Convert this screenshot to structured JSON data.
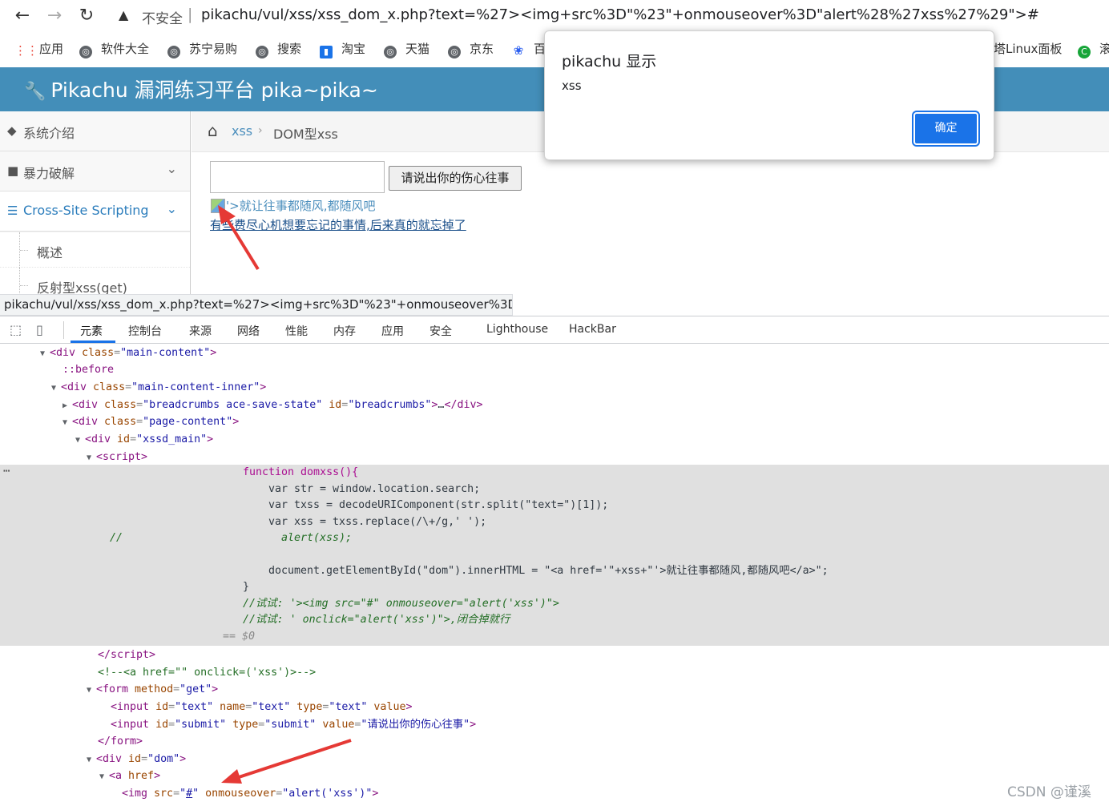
{
  "browser": {
    "back_icon": "back-arrow-icon",
    "forward_icon": "forward-arrow-icon",
    "reload_icon": "reload-icon",
    "insecure_label": "不安全",
    "url": "pikachu/vul/xss/xss_dom_x.php?text=%27><img+src%3D\"%23\"+onmouseover%3D\"alert%28%27xss%27%29\">#",
    "bookmarks": [
      {
        "label": "应用",
        "icon": "apps-grid-icon"
      },
      {
        "label": "软件大全",
        "icon": "globe-icon"
      },
      {
        "label": "苏宁易购",
        "icon": "globe-icon"
      },
      {
        "label": "搜索",
        "icon": "globe-icon"
      },
      {
        "label": "淘宝",
        "icon": "taobao-icon"
      },
      {
        "label": "天猫",
        "icon": "globe-icon"
      },
      {
        "label": "京东",
        "icon": "globe-icon"
      },
      {
        "label": "百",
        "icon": "baidu-paw-icon"
      },
      {
        "label": "塔Linux面板",
        "icon": "globe-icon"
      },
      {
        "label": "滚",
        "icon": "green-c-icon"
      }
    ]
  },
  "app": {
    "title": "Pikachu 漏洞练习平台 pika~pika~",
    "sidebar": [
      {
        "label": "系统介绍"
      },
      {
        "label": "暴力破解"
      },
      {
        "label": "Cross-Site Scripting"
      }
    ],
    "submenu": [
      {
        "label": "概述"
      },
      {
        "label": "反射型xss(get)"
      }
    ],
    "breadcrumb": {
      "xss": "xss",
      "sep": "›",
      "current": "DOM型xss"
    },
    "submit_label": "请说出你的伤心往事",
    "dom_link": "'>就让往事都随风,都随风吧",
    "dom_link2": "有些费尽心机想要忘记的事情,后来真的就忘掉了"
  },
  "status_bar": "pikachu/vul/xss/xss_dom_x.php?text=%27><img+src%3D\"%23\"+onmouseover%3D\"...",
  "alert": {
    "title": "pikachu 显示",
    "message": "xss",
    "ok": "确定"
  },
  "devtools": {
    "tabs": [
      "元素",
      "控制台",
      "来源",
      "网络",
      "性能",
      "内存",
      "应用",
      "安全",
      "Lighthouse",
      "HackBar"
    ]
  },
  "dom": {
    "main_content": "main-content",
    "before": "::before",
    "main_content_inner": "main-content-inner",
    "breadcrumbs_class": "breadcrumbs ace-save-state",
    "breadcrumbs_id": "breadcrumbs",
    "page_content": "page-content",
    "xssd_main": "xssd_main",
    "js": {
      "l1": "function domxss(){",
      "l2": "var str = window.location.search;",
      "l3": "var txss = decodeURIComponent(str.split(\"text=\")[1]);",
      "l4": "var xss = txss.replace(/\\+/g,' ');",
      "l5a": "//",
      "l5b": "alert(xss);",
      "l6": "document.getElementById(\"dom\").innerHTML = \"<a href='\"+xss+\"'>就让往事都随风,都随风吧</a>\";",
      "l7": "}",
      "l8": "//试试: '><img src=\"#\" onmouseover=\"alert('xss')\">",
      "l9": "//试试: ' onclick=\"alert('xss')\">,闭合掉就行",
      "l10": "== $0"
    },
    "comment": "<!--<a href=\"\" onclick=('xss')>-->",
    "form_method": "get",
    "input_text": {
      "id": "text",
      "name": "text",
      "type": "text"
    },
    "input_submit": {
      "id": "submit",
      "type": "submit",
      "value": "请说出你的伤心往事"
    },
    "dom_id": "dom",
    "img_src": "#",
    "img_onmouseover": "alert('xss')"
  },
  "watermark": "CSDN @谨溪"
}
